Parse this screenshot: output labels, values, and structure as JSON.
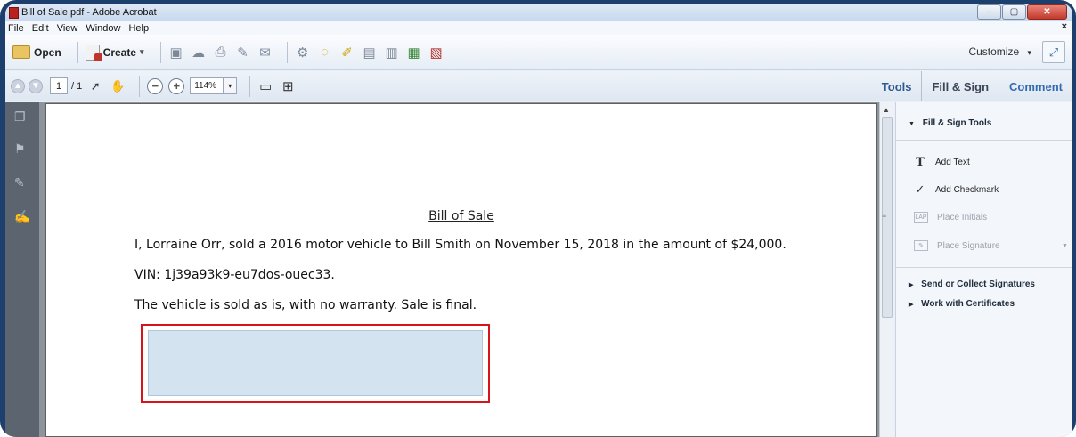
{
  "window": {
    "title": "Bill of Sale.pdf - Adobe Acrobat"
  },
  "menu": {
    "items": [
      "File",
      "Edit",
      "View",
      "Window",
      "Help"
    ],
    "close_glyph": "×"
  },
  "toolbar": {
    "open_label": "Open",
    "create_label": "Create",
    "create_caret": "▾",
    "customize_label": "Customize",
    "customize_caret": "▾"
  },
  "navbar": {
    "page_current": "1",
    "page_total": "/ 1",
    "zoom_value": "114%",
    "zoom_caret": "▾",
    "zoom_out": "−",
    "zoom_in": "+"
  },
  "panel_tabs": {
    "tools": "Tools",
    "fill_sign": "Fill & Sign",
    "comment": "Comment"
  },
  "document": {
    "title": "Bill of Sale",
    "line1": "I, Lorraine Orr, sold a 2016 motor vehicle to Bill Smith on November 15, 2018 in the amount of $24,000.",
    "line2": "VIN: 1j39a93k9-eu7dos-ouec33.",
    "line3": "The vehicle is sold as is, with no warranty.  Sale is final."
  },
  "right_pane": {
    "section_title": "Fill & Sign Tools",
    "items": [
      {
        "label": "Add Text",
        "icon": "text-T-icon",
        "glyph": "T",
        "enabled": true
      },
      {
        "label": "Add Checkmark",
        "icon": "checkmark-icon",
        "glyph": "✓",
        "enabled": true
      },
      {
        "label": "Place Initials",
        "icon": "initials-icon",
        "glyph": "LAP",
        "enabled": false
      },
      {
        "label": "Place Signature",
        "icon": "signature-icon",
        "glyph": "✎",
        "enabled": false
      }
    ],
    "send_collect": "Send or Collect Signatures",
    "certificates": "Work with Certificates"
  },
  "colors": {
    "highlight_outline": "#d7141a",
    "signature_field_fill": "#d3e4f0",
    "accent_blue": "#2f6bb0"
  }
}
